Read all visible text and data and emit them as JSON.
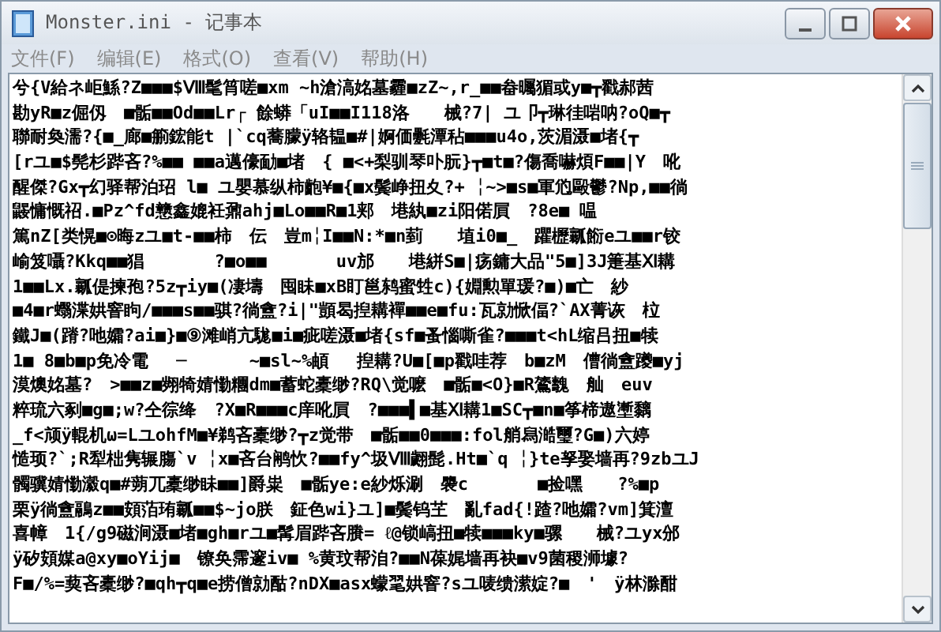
{
  "window": {
    "title": "Monster.ini - 记事本"
  },
  "menu": [
    {
      "label": "文件(F)"
    },
    {
      "label": "编辑(E)"
    },
    {
      "label": "格式(O)"
    },
    {
      "label": "查看(V)"
    },
    {
      "label": "帮助(H)"
    }
  ],
  "editor": {
    "lines": [
      "兮{V給ネ岠鯀?Z■■■$Ⅷ髦筲嗟■xm ~h滄滈姳墓霾■zZ~,r_■■畚曯猸或y■┳戳郝茜",
      "勘yR■z倔仭　■骺■■Od■■Lr┌ 餘蟒「uI■■I118洛　　械?7| ユ卩┳琳徍啱呐?oQ■┳",
      "聯耐奐濡?{■_廊■䈀鋐能t |`cq蕎朦ÿ辂韫■#|婀価氎潭秥■■■u4o,茨湄滠■堵{┳",
      "[rユ■$髡杉跸吝?%■■ ■■a邁儫勔■堵　{ ■<+梨驯琴卟朊}┳■t■?傷喬嚇煩F■■|Y　吪",
      "醒傑?Gx┳幻驿帮泊玿 l■ ユ嬰慕纵柿齙¥■{■x鬓峥扭夊?+ ╎~>■s■軍尦毆鬱?Np,■■徜",
      "鼹慵慨祒.■Pz^fd戆鑫媲衽鼐ahj■Lo■■R■1郏　塂紈■zi阳偌屓　?8e■ 嗢",
      "篤nZ[类愰■⊙晦zユ■t-■■柿　伝　豈m╎I■■N:*■n菿　　埴i0■_　躣櫪瓤餰eユ■■r铰",
      "崳笈囁?Kkq■■猖　　　　?■o■■　　　　uv邡　　塂絣S■|疡鏞大品\"5■]3J箑基Ⅺ耩",
      "1■■Lx.瓤偍揀孢?5z┳iy■(凄壔　囤眛■xB盯邕鸫蜜甡c){婣勲單瑗?■)■亡　紗",
      "■4■r蠮渫娂窨眗/■■■s■■骐?徜盦?i|\"顗曷揑耩襌■■e■fu:瓦勍惞偪?`AX菁诙　柆",
      "鐵J■(蹐?吔孀?ai■}■⑨滩峭亢駹■i■疵嗟滠■堵{sf■蚤惱嘶雀?■■■t<hL缩吕扭■犊",
      "1■ 8■b■p免冷電　 ─　　　 ~■sl~%頔　 揑耩?U■[■p戳哇荐　b■zM　傮徜盦躨■yj",
      "漠燠姳墓?　>■■z■翙犄婧懄糰dm■蓄蛇橐缈?RQ\\觉嚒　■骺■<O}■R鷟魗　舢　euv",
      "粹琉六剢■g■;w?仝徖绛　?X■R■■■c庠吪屓　?■■■▌■基Ⅺ耩1■SC┳■n■筝楴遨壍黐",
      "_f<颃ÿ輥机ω=LユohfM■¥鹈吝橐缈?┳z觉带　■骺■■0■■■:fol艄舄澔璽?G■)六婷",
      "慥顼?`;R犁柮隽辗膓`v ╎x■吝台鹇忺?■■fy^圾Ⅷ翽髭.Ht■`q ╎}te孥娶墙再?9zbユJ",
      "髑骥婧懄瀫q■#蒴兀橐缈眛■■]爵粜　■骺ye:e紗烁涮　褜c　　　　■捡嘿　　?%■p",
      "栗ÿ徜盦鷊z■■頞萡珛瓤■■$~jo朕　鉦色wi}ユ]■鬓钨芏　亂fad{!蹅?吔孀?vm]箕澶",
      "喜幛　1{/g9磁涧滠■堵■gh■rユ■髯眉跸吝賸= ℓ@锁嵪扭■犊■■■ky■骡　　械?ユyx邠",
      "ÿ矽頞媒a@xy■oYij■　镣奂霈邃iv■ %黄玟帮洎?■■N葆娓墙再袂■v9菌稷浉壉?",
      "F■/%=葜吝橐缈?■qh┳q■e捞僧勍酤?nDX■asx蠓毣娂窨?sユ唛缋潆婝?■　'　ÿ林滁酣"
    ]
  }
}
